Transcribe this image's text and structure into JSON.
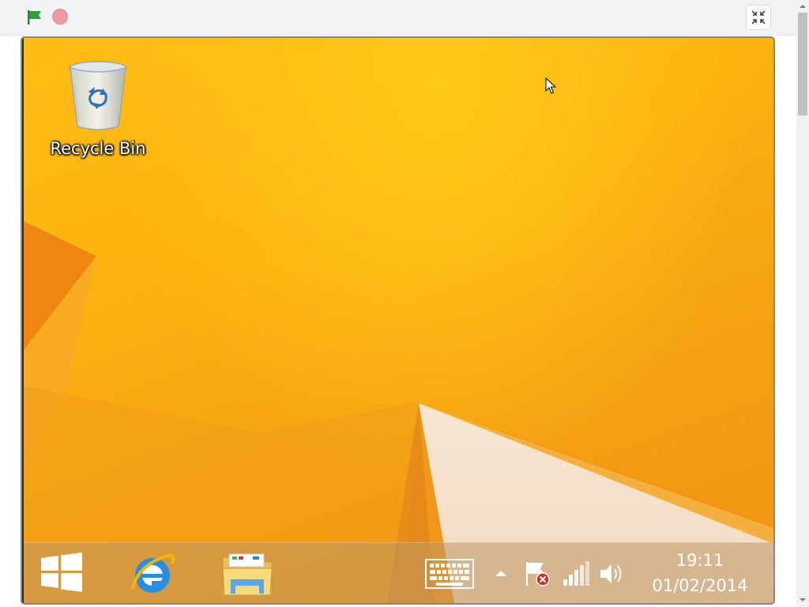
{
  "toolbar": {
    "buttons": [
      {
        "name": "green-flag-icon",
        "color": "#2e9e3e"
      },
      {
        "name": "stop-icon",
        "color": "#ec9aa3"
      },
      {
        "name": "exit-fullscreen-icon",
        "color": "#555555"
      }
    ]
  },
  "desktop": {
    "icons": [
      {
        "label": "Recycle Bin",
        "icon": "recycle-bin-icon"
      }
    ],
    "wallpaper_color": "#fbb10f"
  },
  "taskbar": {
    "pinned": [
      {
        "name": "start-button",
        "icon": "windows-logo-icon"
      },
      {
        "name": "internet-explorer",
        "icon": "internet-explorer-icon"
      },
      {
        "name": "file-explorer",
        "icon": "folder-icon"
      }
    ],
    "tray": [
      {
        "icon": "touch-keyboard-icon"
      },
      {
        "icon": "show-hidden-icons-arrow"
      },
      {
        "icon": "action-center-flag-icon"
      },
      {
        "icon": "network-signal-icon"
      },
      {
        "icon": "speaker-volume-icon"
      }
    ],
    "clock": {
      "time": "19:11",
      "date": "01/02/2014"
    }
  }
}
